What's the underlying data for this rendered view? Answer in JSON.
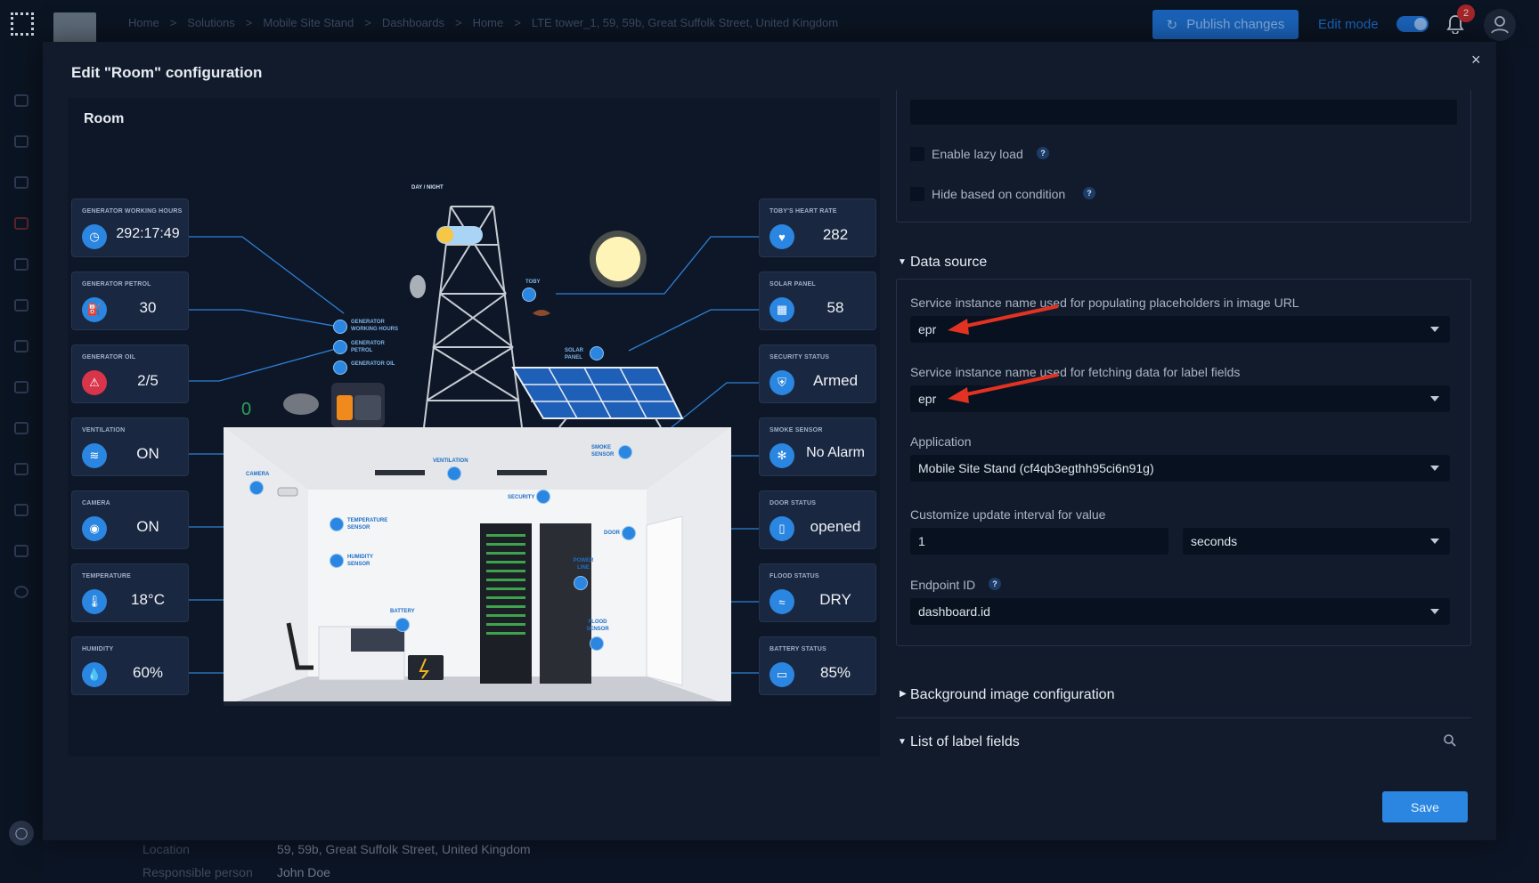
{
  "breadcrumbs": [
    "Home",
    "Solutions",
    "Mobile Site Stand",
    "Dashboards",
    "Home",
    "LTE tower_1, 59, 59b, Great Suffolk Street, United Kingdom"
  ],
  "topbar": {
    "publish_label": "Publish changes",
    "edit_mode_label": "Edit mode",
    "notification_count": "2",
    "icons": [
      "brand-icon",
      "refresh-icon",
      "lock-icon",
      "bell-icon",
      "user-icon"
    ]
  },
  "background_details": {
    "location_label": "Location",
    "location_value": "59, 59b, Great Suffolk Street, United Kingdom",
    "responsible_label": "Responsible person",
    "responsible_value": "John Doe"
  },
  "modal": {
    "title": "Edit \"Room\" configuration",
    "close_glyph": "×",
    "save_label": "Save"
  },
  "room": {
    "title": "Room",
    "left_cards": [
      {
        "label": "GENERATOR WORKING HOURS",
        "value": "292:17:49",
        "icon": "clock-icon",
        "color": "#2a86e0"
      },
      {
        "label": "GENERATOR PETROL",
        "value": "30",
        "icon": "fuel-icon",
        "color": "#2a86e0"
      },
      {
        "label": "GENERATOR OIL",
        "value": "2/5",
        "icon": "oil-icon",
        "color": "#d8344a"
      },
      {
        "label": "VENTILATION",
        "value": "ON",
        "icon": "fan-icon",
        "color": "#2a86e0"
      },
      {
        "label": "CAMERA",
        "value": "ON",
        "icon": "camera-icon",
        "color": "#2a86e0"
      },
      {
        "label": "TEMPERATURE",
        "value": "18°C",
        "icon": "thermometer-icon",
        "color": "#2a86e0"
      },
      {
        "label": "HUMIDITY",
        "value": "60%",
        "icon": "droplet-icon",
        "color": "#2a86e0"
      }
    ],
    "right_cards": [
      {
        "label": "TOBY'S HEART RATE",
        "value": "282",
        "icon": "bird-icon",
        "color": "#2a86e0"
      },
      {
        "label": "SOLAR PANEL",
        "value": "58",
        "icon": "solar-icon",
        "color": "#2a86e0"
      },
      {
        "label": "SECURITY STATUS",
        "value": "Armed",
        "icon": "shield-icon",
        "color": "#2a86e0"
      },
      {
        "label": "SMOKE SENSOR",
        "value": "No Alarm",
        "icon": "smoke-icon",
        "color": "#2a86e0"
      },
      {
        "label": "DOOR STATUS",
        "value": "opened",
        "icon": "door-icon",
        "color": "#2a86e0"
      },
      {
        "label": "FLOOD STATUS",
        "value": "DRY",
        "icon": "wave-icon",
        "color": "#2a86e0"
      },
      {
        "label": "BATTERY STATUS",
        "value": "85%",
        "icon": "battery-icon",
        "color": "#2a86e0"
      }
    ],
    "scene_labels": {
      "day_night": "DAY / NIGHT",
      "toby": "TOBY",
      "gen_hours": "GENERATOR WORKING HOURS",
      "gen_petrol": "GENERATOR PETROL",
      "gen_oil": "GENERATOR OIL",
      "solar_panel": "SOLAR PANEL",
      "ventilation": "VENTILATION",
      "camera": "CAMERA",
      "smoke_sensor": "SMOKE SENSOR",
      "security": "SECURITY",
      "temperature_sensor": "TEMPERATURE SENSOR",
      "humidity_sensor": "HUMIDITY SENSOR",
      "door": "DOOR",
      "power_line": "POWER LINE",
      "battery": "BATTERY",
      "flood_sensor": "FLOOD SENSOR",
      "generator_counter": "0"
    }
  },
  "settings": {
    "lazy_load_label": "Enable lazy load",
    "hide_condition_label": "Hide based on condition",
    "data_source_title": "Data source",
    "service_image_label": "Service instance name used for populating placeholders in image URL",
    "service_image_value": "epr",
    "service_label_label": "Service instance name used for fetching data for label fields",
    "service_label_value": "epr",
    "application_label": "Application",
    "application_value": "Mobile Site Stand (cf4qb3egthh95ci6n91g)",
    "interval_label": "Customize update interval for value",
    "interval_value": "1",
    "interval_unit": "seconds",
    "endpoint_label": "Endpoint ID",
    "endpoint_value": "dashboard.id",
    "background_title": "Background image configuration",
    "label_fields_title": "List of label fields",
    "help_glyph": "?"
  }
}
